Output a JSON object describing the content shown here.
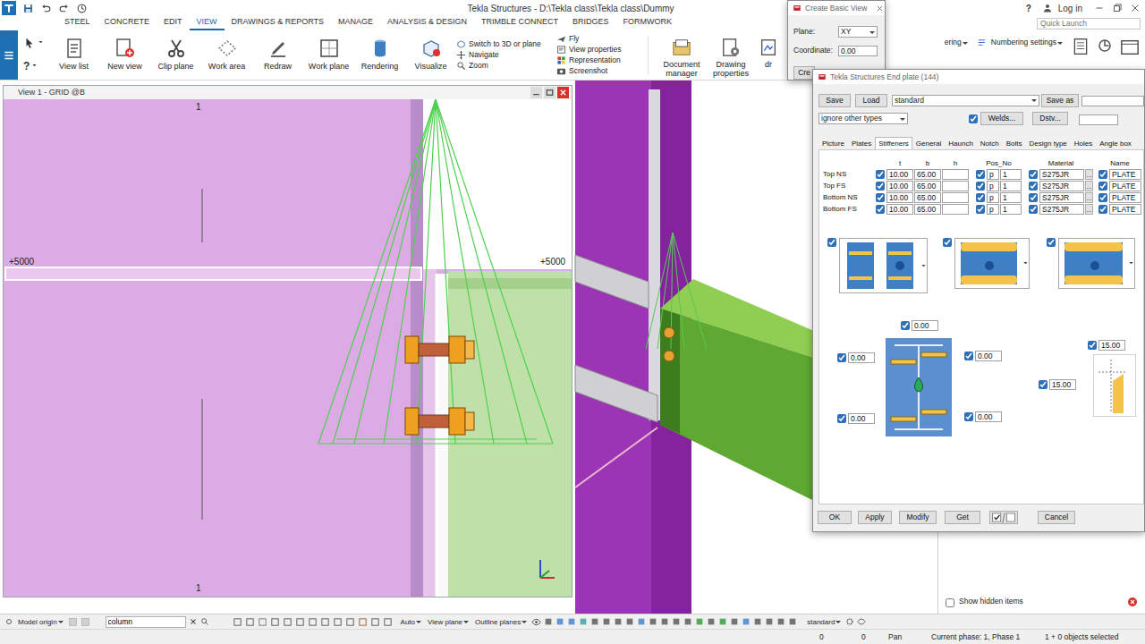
{
  "window": {
    "title": "Tekla Structures - D:\\Tekla class\\Tekla class\\Dummy",
    "help": "?",
    "login": "Log in"
  },
  "menu_tabs": [
    {
      "label": "STEEL",
      "selected": false
    },
    {
      "label": "CONCRETE",
      "selected": false
    },
    {
      "label": "EDIT",
      "selected": false
    },
    {
      "label": "VIEW",
      "selected": true
    },
    {
      "label": "DRAWINGS & REPORTS",
      "selected": false
    },
    {
      "label": "MANAGE",
      "selected": false
    },
    {
      "label": "ANALYSIS & DESIGN",
      "selected": false
    },
    {
      "label": "TRIMBLE CONNECT",
      "selected": false
    },
    {
      "label": "BRIDGES",
      "selected": false
    },
    {
      "label": "FORMWORK",
      "selected": false
    }
  ],
  "quick_launch": {
    "placeholder": "Quick Launch"
  },
  "ribbon": {
    "help_tool": "?",
    "large": [
      "View list",
      "New view",
      "Clip plane",
      "Work area",
      "Redraw",
      "Work plane",
      "Rendering",
      "Visualize"
    ],
    "small_col1": [
      "Switch to 3D or plane",
      "Navigate",
      "Zoom"
    ],
    "small_col2": [
      "Fly",
      "View properties",
      "Representation",
      "Screenshot"
    ],
    "large2": [
      "Document manager",
      "Drawing properties",
      "dr"
    ],
    "numbering": "ering",
    "numbering_settings": "Numbering settings"
  },
  "create_view_dialog": {
    "title": "Create Basic View",
    "plane_label": "Plane:",
    "plane": "XY",
    "coordinate_label": "Coordinate:",
    "coordinate": "0.00",
    "create": "Cre"
  },
  "view_window": {
    "title": "View 1 - GRID @B",
    "grid_top": "1",
    "grid_bottom": "1",
    "level_left": "+5000",
    "level_right": "+5000"
  },
  "end_plate_dialog": {
    "title": "Tekla Structures  End plate (144)",
    "save": "Save",
    "load": "Load",
    "preset": "standard",
    "save_as": "Save as",
    "save_as_name": "",
    "filter": "ignore other types",
    "welds": {
      "label": "Welds...",
      "checked": true
    },
    "dstv": "Dstv...",
    "dstv_value": "",
    "tabs": [
      {
        "label": "Picture",
        "selected": false
      },
      {
        "label": "Plates",
        "selected": false
      },
      {
        "label": "Stiffeners",
        "selected": true
      },
      {
        "label": "General",
        "selected": false
      },
      {
        "label": "Haunch",
        "selected": false
      },
      {
        "label": "Notch",
        "selected": false
      },
      {
        "label": "Bolts",
        "selected": false
      },
      {
        "label": "Design type",
        "selected": false
      },
      {
        "label": "Holes",
        "selected": false
      },
      {
        "label": "Angle box",
        "selected": false
      }
    ],
    "columns": {
      "t": "t",
      "b": "b",
      "h": "h",
      "pos_no": "Pos_No",
      "material": "Material",
      "name": "Name"
    },
    "rows": [
      {
        "label": "Top NS",
        "checked": true,
        "t": "10.00",
        "b": "65.00",
        "h": "",
        "pos_checked": true,
        "prefix": "p",
        "start": "1",
        "material_checked": true,
        "material": "S275JR",
        "name_checked": true,
        "name": "PLATE"
      },
      {
        "label": "Top FS",
        "checked": true,
        "t": "10.00",
        "b": "65.00",
        "h": "",
        "pos_checked": true,
        "prefix": "p",
        "start": "1",
        "material_checked": true,
        "material": "S275JR",
        "name_checked": true,
        "name": "PLATE"
      },
      {
        "label": "Bottom NS",
        "checked": true,
        "t": "10.00",
        "b": "65.00",
        "h": "",
        "pos_checked": true,
        "prefix": "p",
        "start": "1",
        "material_checked": true,
        "material": "S275JR",
        "name_checked": true,
        "name": "PLATE"
      },
      {
        "label": "Bottom FS",
        "checked": true,
        "t": "10.00",
        "b": "65.00",
        "h": "",
        "pos_checked": true,
        "prefix": "p",
        "start": "1",
        "material_checked": true,
        "material": "S275JR",
        "name_checked": true,
        "name": "PLATE"
      }
    ],
    "browse": "...",
    "pictures": [
      {
        "checked": true
      },
      {
        "checked": true
      },
      {
        "checked": true
      }
    ],
    "section_fields": [
      {
        "value": "0.00",
        "checked": true
      },
      {
        "value": "0.00",
        "checked": true
      },
      {
        "value": "0.00",
        "checked": true
      },
      {
        "value": "0.00",
        "checked": true
      },
      {
        "value": "0.00",
        "checked": true
      }
    ],
    "detail_fields": [
      {
        "value": "15.00",
        "checked": true
      },
      {
        "value": "15.00",
        "checked": true
      }
    ],
    "buttons": {
      "ok": "OK",
      "apply": "Apply",
      "modify": "Modify",
      "get": "Get",
      "cancel": "Cancel"
    }
  },
  "side_panel": {
    "show_hidden": {
      "label": "Show hidden items",
      "checked": false
    }
  },
  "bottom_toolbar": {
    "origin": "Model origin",
    "filter": "column",
    "auto": "Auto",
    "view_plane": "View plane",
    "outline": "Outline planes",
    "settings": "standard"
  },
  "status_bar": {
    "x": "0",
    "y": "0",
    "mode": "Pan",
    "phase": "Current phase: 1, Phase 1",
    "selection": "1 + 0 objects selected"
  }
}
